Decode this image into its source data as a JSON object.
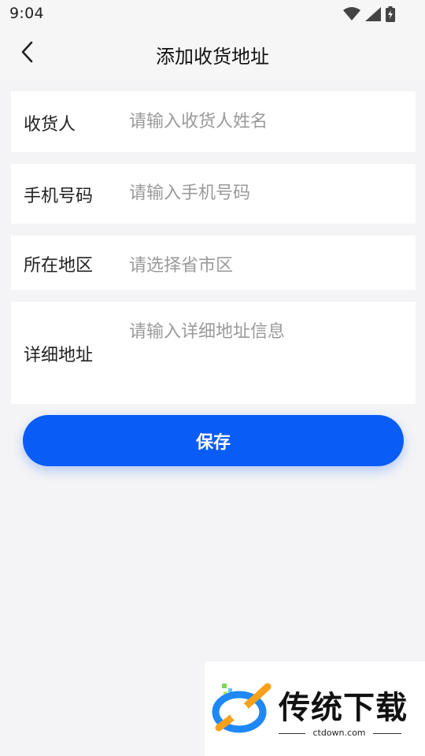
{
  "status_bar": {
    "time": "9:04",
    "icons": [
      "wifi-icon",
      "cell-signal-icon",
      "battery-icon"
    ]
  },
  "header": {
    "title": "添加收货地址",
    "back_icon": "chevron-left-icon"
  },
  "form": {
    "recipient": {
      "label": "收货人",
      "placeholder": "请输入收货人姓名"
    },
    "phone": {
      "label": "手机号码",
      "placeholder": "请输入手机号码"
    },
    "region": {
      "label": "所在地区",
      "placeholder": "请选择省市区"
    },
    "address": {
      "label": "详细地址",
      "placeholder": "请输入详细地址信息"
    }
  },
  "actions": {
    "save_label": "保存"
  },
  "watermark": {
    "brand": "传统下载",
    "url": "ctdown.com"
  },
  "colors": {
    "accent": "#0a5cf6",
    "background": "#f4f4f6",
    "placeholder": "#9a9a9a"
  }
}
